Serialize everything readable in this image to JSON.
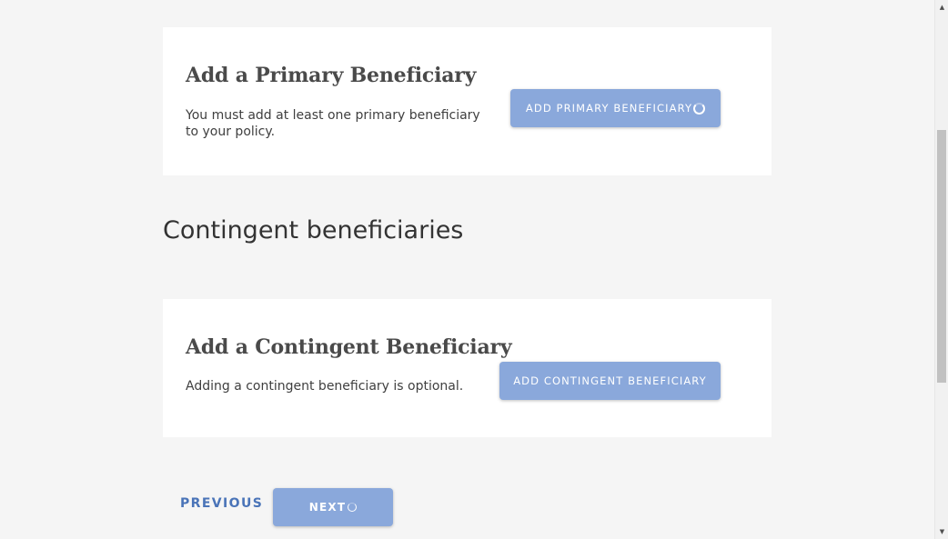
{
  "primary_card": {
    "title": "Add a Primary Beneficiary",
    "description": "You must add at least one primary beneficiary to your policy.",
    "button_label": "ADD PRIMARY BENEFICIARY",
    "button_loading": true
  },
  "contingent_section": {
    "heading": "Contingent beneficiaries"
  },
  "contingent_card": {
    "title": "Add a Contingent Beneficiary",
    "description": "Adding a contingent beneficiary is optional.",
    "button_label": "ADD CONTINGENT BENEFICIARY"
  },
  "navigation": {
    "previous_label": "PREVIOUS",
    "next_label": "NEXT",
    "next_loading": true
  },
  "colors": {
    "page_background": "#f5f5f5",
    "card_background": "#ffffff",
    "button_background": "#8aa8db",
    "link_color": "#4a74b8"
  },
  "icons": {
    "loading_spinner": "spinner-icon",
    "scroll_up": "scroll-up-arrow-icon",
    "scroll_down": "scroll-down-arrow-icon"
  }
}
